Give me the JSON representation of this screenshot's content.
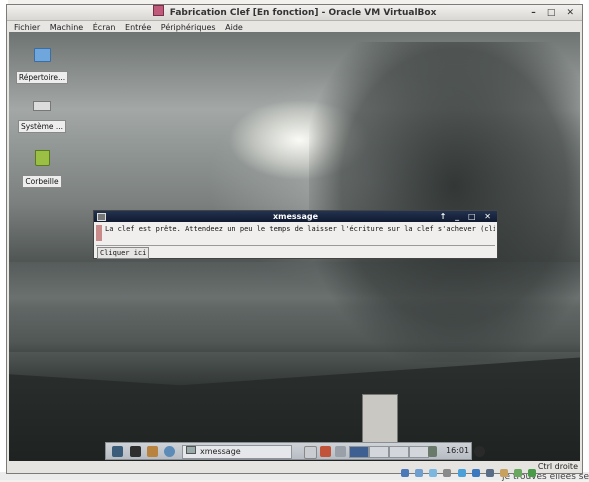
{
  "host": {
    "bottom_text": "je trouves ellées se"
  },
  "window": {
    "title": "Fabrication Clef [En fonction] - Oracle VM VirtualBox",
    "controls": "– □ ✕"
  },
  "menu": {
    "items": [
      "Fichier",
      "Machine",
      "Écran",
      "Entrée",
      "Périphériques",
      "Aide"
    ]
  },
  "desktop": {
    "icons": [
      {
        "label": "Répertoire...",
        "icon": "folder-icon"
      },
      {
        "label": "Système ...",
        "icon": "drive-icon"
      },
      {
        "label": "Corbeille",
        "icon": "trash-icon"
      }
    ]
  },
  "xmessage": {
    "title": "xmessage",
    "controls": "↑ _ □ ✕",
    "message": "La clef est prête. Attendeez un peu le temps de laisser l'écriture sur la clef s'achever (cligonter",
    "button": "Cliquer ici"
  },
  "panel": {
    "task_label": "xmessage",
    "clock": "16:01",
    "icons": [
      "menu-icon",
      "terminal-icon",
      "file-manager-icon",
      "browser-icon"
    ]
  },
  "statusbar": {
    "host_key": "Ctrl droite"
  },
  "colors": {
    "xmessage_titlebar": "#1a2640",
    "panel": "#c3c7cd"
  }
}
